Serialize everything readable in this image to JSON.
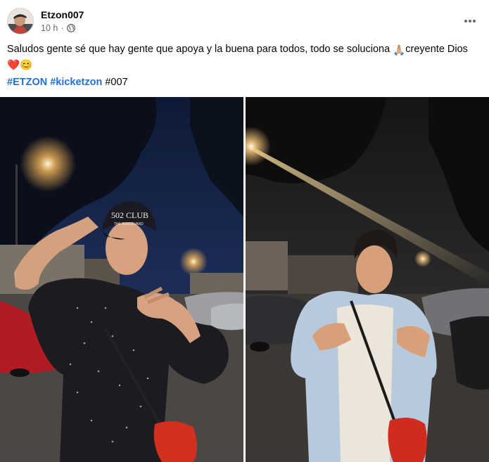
{
  "post": {
    "author": "Etzon007",
    "time": "10 h",
    "separator": "·",
    "audience_icon": "globe-icon",
    "menu_icon": "more-horizontal-icon",
    "caption_text": "Saludos gente sé que hay gente que apoya y la buena para todos, todo se soluciona ",
    "caption_prayer": "🙏🏼",
    "caption_text2": "creyente Dios ",
    "caption_heart": "❤️",
    "caption_smile": "😊",
    "hashtags": [
      "#ETZON",
      "#kicketzon"
    ],
    "plain_tag": "#007",
    "cap_text": "502 CLUB",
    "cap_subtext": "THE BOULEVARD",
    "colors": {
      "link": "#216fdb",
      "meta": "#65676b",
      "text": "#050505"
    }
  }
}
